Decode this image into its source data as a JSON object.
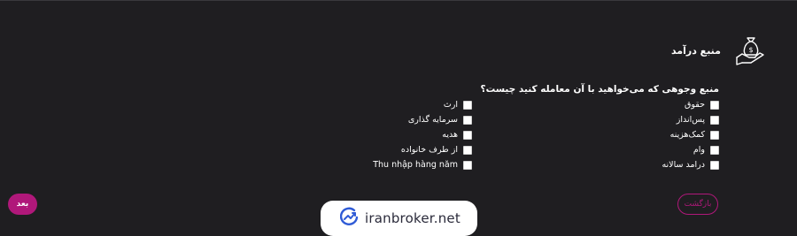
{
  "header": {
    "title": "منبع درآمد",
    "icon": "money-bag-hand-icon"
  },
  "question": "منبع وجوهی که می‌خواهید با آن معامله کنید چیست؟",
  "options_right": [
    {
      "label": "حقوق",
      "checked": false
    },
    {
      "label": "پس‌انداز",
      "checked": false
    },
    {
      "label": "کمک‌هزینه",
      "checked": false
    },
    {
      "label": "وام",
      "checked": false
    },
    {
      "label": "درامد سالانه",
      "checked": false
    }
  ],
  "options_left": [
    {
      "label": "ارث",
      "checked": false
    },
    {
      "label": "سرمایه گذاری",
      "checked": false
    },
    {
      "label": "هدیه",
      "checked": false
    },
    {
      "label": "از طرف خانواده",
      "checked": false
    },
    {
      "label": "Thu nhập hàng năm",
      "checked": false
    }
  ],
  "buttons": {
    "back": "بازگشت",
    "next": "بعد"
  },
  "brand": {
    "name": "iranbroker.net",
    "icon": "growth-chart-logo-icon"
  },
  "colors": {
    "background": "#1f1e21",
    "accent": "#b0187a",
    "text": "#ffffff"
  }
}
